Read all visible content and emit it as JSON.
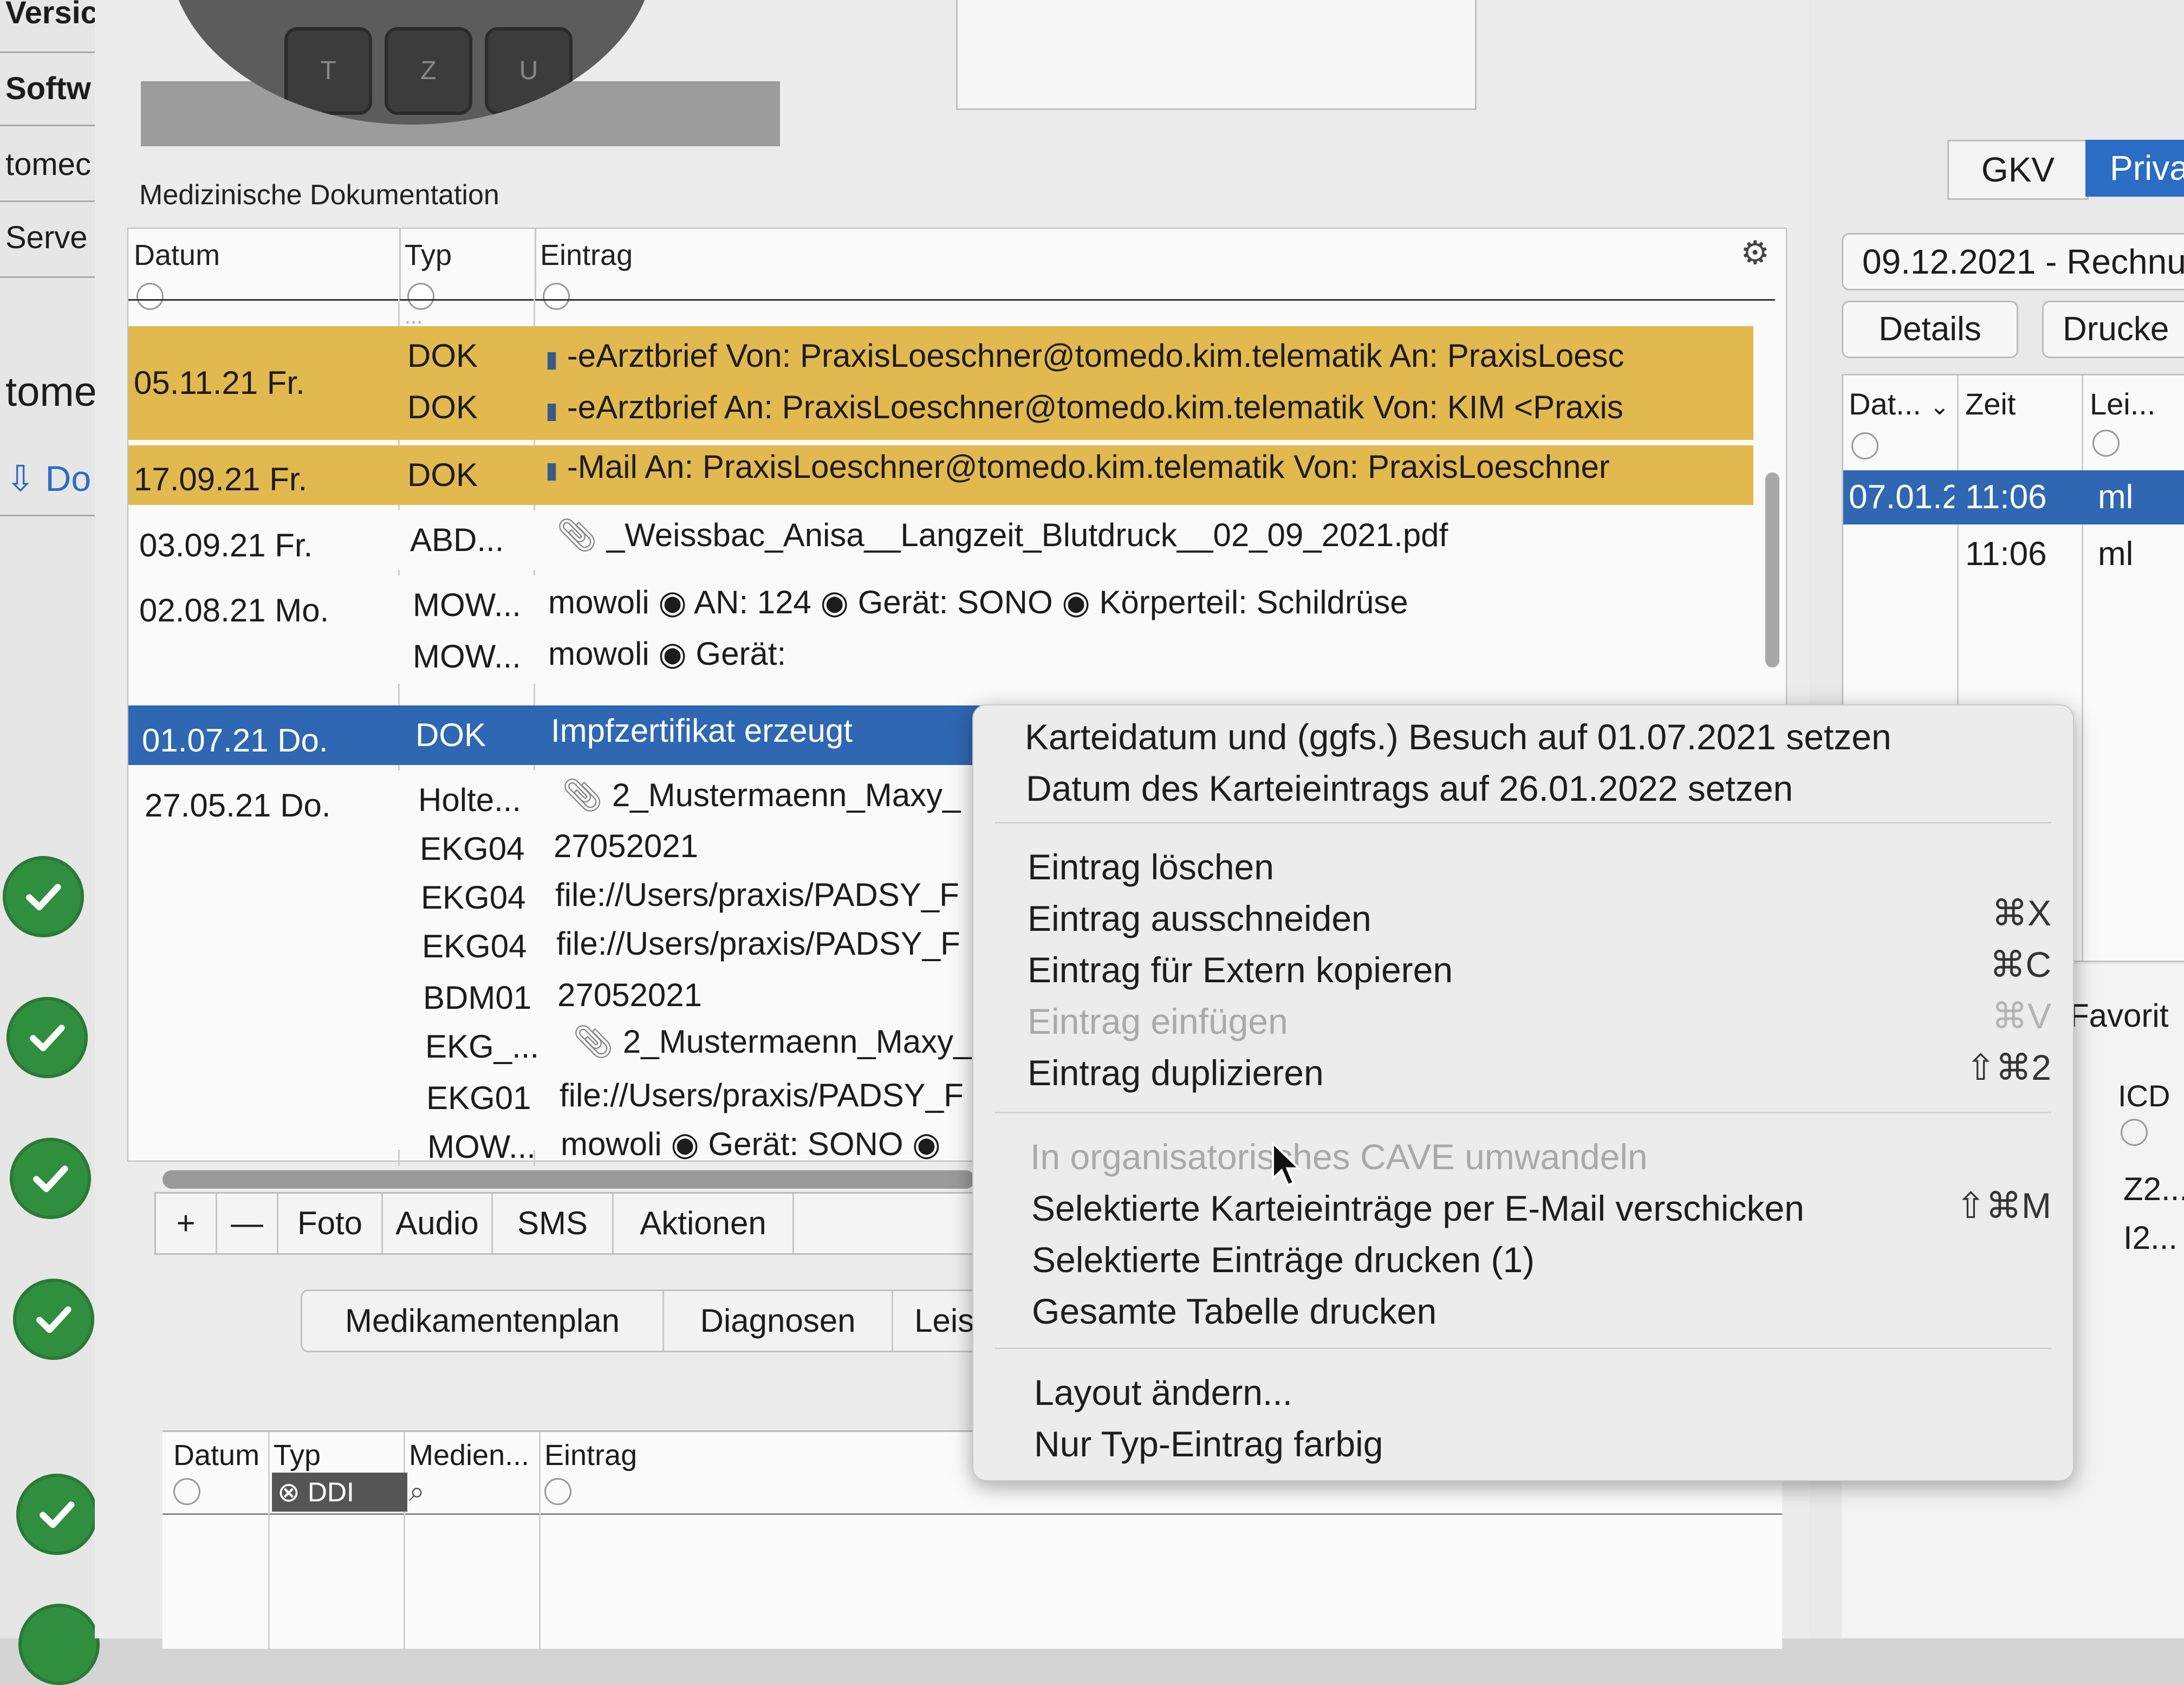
{
  "left_strip": {
    "labels": [
      "Versic",
      "Softw",
      "tomec",
      "Serve",
      "tomec",
      "Do"
    ]
  },
  "main": {
    "section_title": "Medizinische Dokumentation",
    "columns": {
      "datum": "Datum",
      "typ": "Typ",
      "eintrag": "Eintrag"
    },
    "partial_row_text": "...",
    "rows": [
      {
        "datum": "05.11.21  Fr.",
        "typ": "DOK",
        "eintrag": "-eArztbrief  Von: PraxisLoeschner@tomedo.kim.telematik   An: PraxisLoesc",
        "style": "yellow"
      },
      {
        "datum": "",
        "typ": "DOK",
        "eintrag": "-eArztbrief   An: PraxisLoeschner@tomedo.kim.telematik   Von: KIM <Praxis",
        "style": "yellow"
      },
      {
        "datum": "17.09.21  Fr.",
        "typ": "DOK",
        "eintrag": "-Mail An: PraxisLoeschner@tomedo.kim.telematik       Von: PraxisLoeschner",
        "style": "yellow"
      },
      {
        "datum": "03.09.21  Fr.",
        "typ": "ABD...",
        "eintrag": "_Weissbac_Anisa__Langzeit_Blutdruck__02_09_2021.pdf",
        "style": "white"
      },
      {
        "datum": "02.08.21  Mo.",
        "typ": "MOW...",
        "eintrag": "mowoli ◉ AN: 124 ◉ Gerät: SONO ◉ Körperteil: Schildrüse",
        "style": "white"
      },
      {
        "datum": "",
        "typ": "MOW...",
        "eintrag": "mowoli ◉ Gerät:",
        "style": "white"
      },
      {
        "datum": "01.07.21  Do.",
        "typ": "DOK",
        "eintrag": "Impfzertifikat erzeugt",
        "style": "selected"
      },
      {
        "datum": "27.05.21  Do.",
        "typ": "Holte...",
        "eintrag": "2_Mustermaenn_Maxy_",
        "style": "white"
      },
      {
        "datum": "",
        "typ": "EKG04",
        "eintrag": "27052021",
        "style": "white"
      },
      {
        "datum": "",
        "typ": "EKG04",
        "eintrag": "file://Users/praxis/PADSY_F",
        "style": "white"
      },
      {
        "datum": "",
        "typ": "EKG04",
        "eintrag": "file://Users/praxis/PADSY_F",
        "style": "white"
      },
      {
        "datum": "",
        "typ": "BDM01",
        "eintrag": "27052021",
        "style": "white"
      },
      {
        "datum": "",
        "typ": "EKG_...",
        "eintrag": "2_Mustermaenn_Maxy_",
        "style": "white"
      },
      {
        "datum": "",
        "typ": "EKG01",
        "eintrag": "file://Users/praxis/PADSY_F",
        "style": "white"
      },
      {
        "datum": "",
        "typ": "MOW...",
        "eintrag": "mowoli ◉ Gerät: SONO ◉",
        "style": "white"
      }
    ],
    "toolbar": {
      "add": "+",
      "remove": "—",
      "foto": "Foto",
      "audio": "Audio",
      "sms": "SMS",
      "aktionen": "Aktionen"
    },
    "bottom_tabs": [
      "Medikamentenplan",
      "Diagnosen",
      "Leist"
    ],
    "lower_table": {
      "columns": [
        "Datum",
        "Typ",
        "Medien...",
        "Eintrag"
      ],
      "filter_badge": "DDI"
    }
  },
  "right_panel": {
    "segment_gkv": "GKV",
    "segment_privat": "Priva",
    "invoice_select": "09.12.2021 - Rechnu",
    "details_button": "Details",
    "print_button": "Drucke",
    "columns": [
      "Dat...",
      "Zeit",
      "Lei..."
    ],
    "rows": [
      {
        "dat": "07.01.2",
        "zeit": "11:06",
        "lei": "ml",
        "selected": true
      },
      {
        "dat": "",
        "zeit": "11:06",
        "lei": "ml",
        "selected": false
      }
    ],
    "favorites_label": "Favorit",
    "icd_label": "ICD",
    "icd_rows": [
      "Z2...",
      "I2..."
    ]
  },
  "context_menu": {
    "items": [
      {
        "label": "Karteidatum und (ggfs.) Besuch auf 01.07.2021 setzen",
        "shortcut": "",
        "disabled": false
      },
      {
        "label": "Datum des Karteieintrags auf 26.01.2022 setzen",
        "shortcut": "",
        "disabled": false
      },
      {
        "label": "Eintrag löschen",
        "shortcut": "",
        "disabled": false
      },
      {
        "label": "Eintrag ausschneiden",
        "shortcut": "⌘X",
        "disabled": false
      },
      {
        "label": "Eintrag für Extern kopieren",
        "shortcut": "⌘C",
        "disabled": false
      },
      {
        "label": "Eintrag einfügen",
        "shortcut": "⌘V",
        "disabled": true
      },
      {
        "label": "Eintrag duplizieren",
        "shortcut": "⇧⌘2",
        "disabled": false
      },
      {
        "label": "In organisatorisches CAVE umwandeln",
        "shortcut": "",
        "disabled": true
      },
      {
        "label": "Selektierte Karteieinträge per E-Mail verschicken",
        "shortcut": "⇧⌘M",
        "disabled": false
      },
      {
        "label": "Selektierte Einträge drucken (1)",
        "shortcut": "",
        "disabled": false
      },
      {
        "label": "Gesamte Tabelle drucken",
        "shortcut": "",
        "disabled": false
      },
      {
        "label": "Layout ändern...",
        "shortcut": "",
        "disabled": false
      },
      {
        "label": "Nur Typ-Eintrag farbig",
        "shortcut": "",
        "disabled": false
      }
    ]
  },
  "colors": {
    "accent": "#2f67b2",
    "highlight_yellow": "#e2b94e",
    "check_green": "#2f8f3e"
  }
}
